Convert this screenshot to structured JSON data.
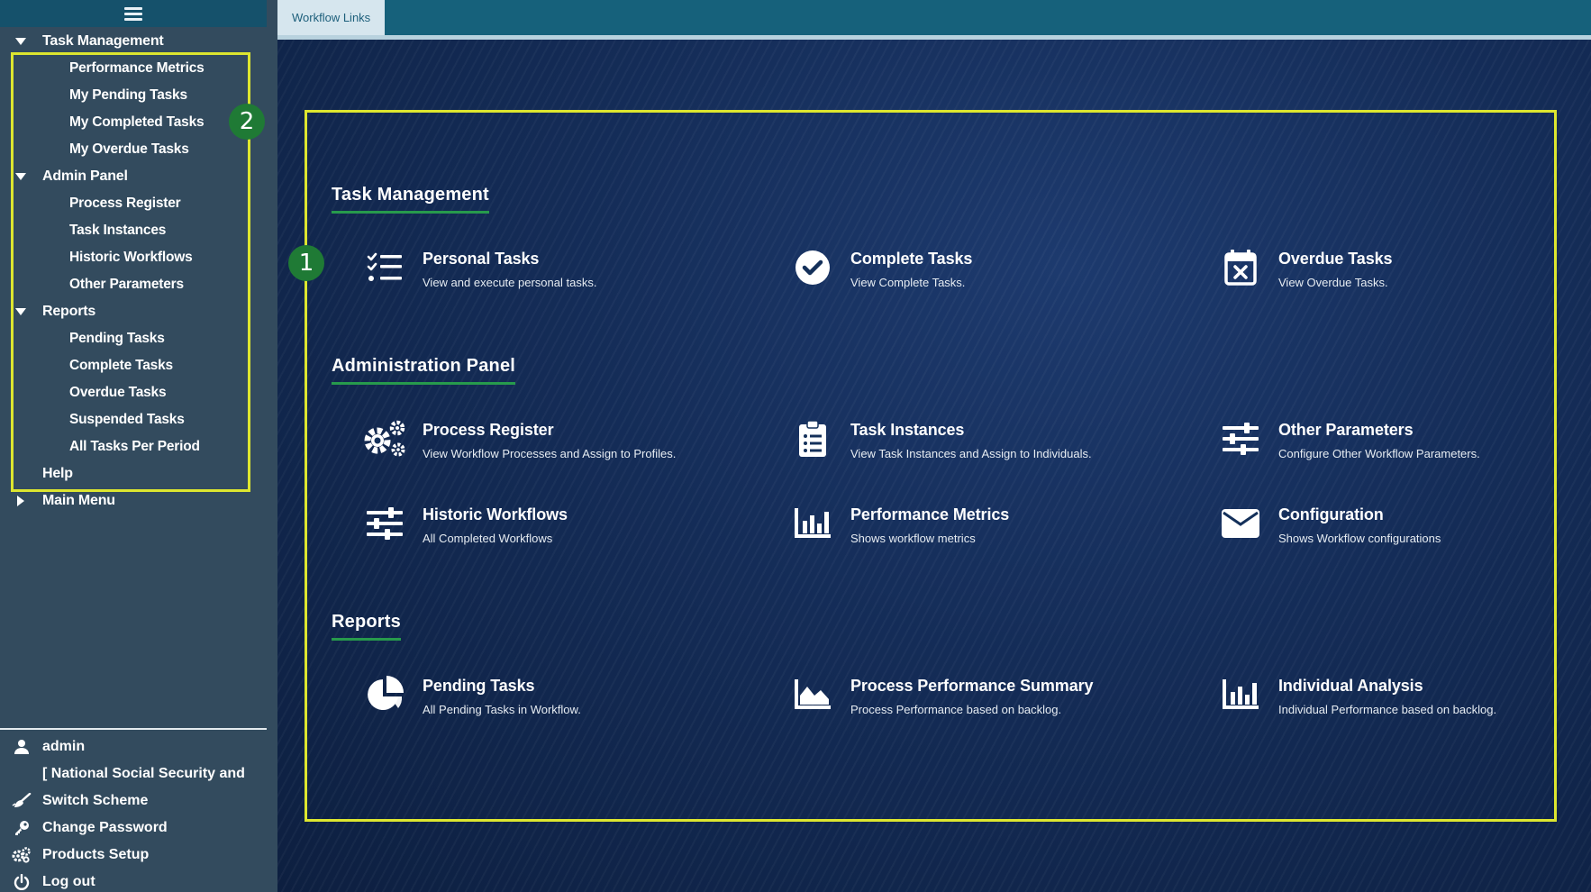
{
  "sidebar": {
    "tree": [
      {
        "label": "Task Management",
        "level": 0,
        "expanded": true
      },
      {
        "label": "Performance Metrics",
        "level": 1
      },
      {
        "label": "My Pending Tasks",
        "level": 1
      },
      {
        "label": "My Completed Tasks",
        "level": 1
      },
      {
        "label": "My Overdue Tasks",
        "level": 1
      },
      {
        "label": "Admin Panel",
        "level": 0,
        "expanded": true
      },
      {
        "label": "Process Register",
        "level": 1
      },
      {
        "label": "Task Instances",
        "level": 1
      },
      {
        "label": "Historic Workflows",
        "level": 1
      },
      {
        "label": "Other Parameters",
        "level": 1
      },
      {
        "label": "Reports",
        "level": 0,
        "expanded": true
      },
      {
        "label": "Pending Tasks",
        "level": 1
      },
      {
        "label": "Complete Tasks",
        "level": 1
      },
      {
        "label": "Overdue Tasks",
        "level": 1
      },
      {
        "label": "Suspended Tasks",
        "level": 1
      },
      {
        "label": "All Tasks Per Period",
        "level": 1
      },
      {
        "label": "Help",
        "level": 0,
        "expanded": null
      },
      {
        "label": "Main Menu",
        "level": 0,
        "expanded": false
      }
    ],
    "user": {
      "username": "admin",
      "organization": "[ National Social Security and",
      "switch_scheme": "Switch Scheme",
      "change_password": "Change Password",
      "products_setup": "Products Setup",
      "logout": "Log out"
    },
    "badge": "2"
  },
  "tabs": [
    {
      "label": "Workflow Links"
    }
  ],
  "main": {
    "badge": "1",
    "sections": [
      {
        "title": "Task Management",
        "cards": [
          {
            "title": "Personal Tasks",
            "desc": "View and execute personal tasks.",
            "icon": "tasks-list-icon"
          },
          {
            "title": "Complete Tasks",
            "desc": "View Complete Tasks.",
            "icon": "check-circle-icon"
          },
          {
            "title": "Overdue Tasks",
            "desc": "View Overdue Tasks.",
            "icon": "calendar-x-icon"
          }
        ]
      },
      {
        "title": "Administration Panel",
        "cards": [
          {
            "title": "Process Register",
            "desc": "View Workflow Processes and Assign to Profiles.",
            "icon": "gears-icon"
          },
          {
            "title": "Task Instances",
            "desc": "View Task Instances and Assign to Individuals.",
            "icon": "clipboard-list-icon"
          },
          {
            "title": "Other Parameters",
            "desc": "Configure Other Workflow Parameters.",
            "icon": "sliders-icon"
          },
          {
            "title": "Historic Workflows",
            "desc": "All Completed Workflows",
            "icon": "sliders-icon"
          },
          {
            "title": "Performance Metrics",
            "desc": "Shows workflow metrics",
            "icon": "bar-chart-icon"
          },
          {
            "title": "Configuration",
            "desc": "Shows Workflow configurations",
            "icon": "envelope-icon"
          }
        ]
      },
      {
        "title": "Reports",
        "cards": [
          {
            "title": "Pending Tasks",
            "desc": "All Pending Tasks in Workflow.",
            "icon": "pie-chart-icon"
          },
          {
            "title": "Process Performance Summary",
            "desc": "Process Performance based on backlog.",
            "icon": "area-chart-icon"
          },
          {
            "title": "Individual Analysis",
            "desc": "Individual Performance based on backlog.",
            "icon": "bar-chart-icon"
          }
        ]
      }
    ]
  },
  "colors": {
    "highlight_border": "#dde62f",
    "badge_green": "#1f7a35",
    "section_underline": "#279a4c",
    "sidebar_bg": "#334b5e",
    "tabbar_bg": "#16617b"
  }
}
